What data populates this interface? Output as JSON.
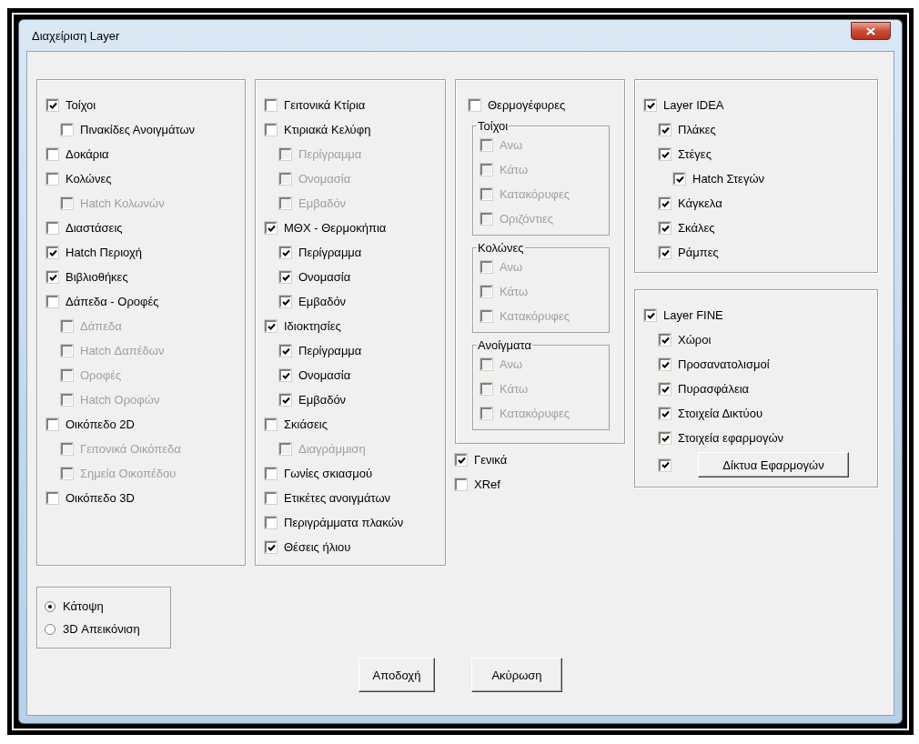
{
  "window": {
    "title": "Διαχείριση Layer"
  },
  "column_1": {
    "items": [
      {
        "label": "Τοίχοι",
        "checked": true,
        "disabled": false,
        "children": [
          {
            "label": "Πινακίδες Ανοιγμάτων",
            "checked": false,
            "disabled": false
          }
        ]
      },
      {
        "label": "Δοκάρια",
        "checked": false,
        "disabled": false
      },
      {
        "label": "Κολώνες",
        "checked": false,
        "disabled": false,
        "children": [
          {
            "label": "Hatch Κολωνών",
            "checked": false,
            "disabled": true
          }
        ]
      },
      {
        "label": "Διαστάσεις",
        "checked": false,
        "disabled": false
      },
      {
        "label": "Hatch Περιοχή",
        "checked": true,
        "disabled": false
      },
      {
        "label": "Βιβλιοθήκες",
        "checked": true,
        "disabled": false
      },
      {
        "label": "Δάπεδα - Οροφές",
        "checked": false,
        "disabled": false,
        "children": [
          {
            "label": "Δάπεδα",
            "checked": false,
            "disabled": true
          },
          {
            "label": "Hatch Δαπέδων",
            "checked": false,
            "disabled": true
          },
          {
            "label": "Οροφές",
            "checked": false,
            "disabled": true
          },
          {
            "label": "Hatch Οροφών",
            "checked": false,
            "disabled": true
          }
        ]
      },
      {
        "label": "Οικόπεδο 2D",
        "checked": false,
        "disabled": false,
        "children": [
          {
            "label": "Γειτονικά Οικόπεδα",
            "checked": false,
            "disabled": true
          },
          {
            "label": "Σημεία Οικοπέδου",
            "checked": false,
            "disabled": true
          }
        ]
      },
      {
        "label": "Οικόπεδο 3D",
        "checked": false,
        "disabled": false
      }
    ]
  },
  "column_2": {
    "items": [
      {
        "label": "Γειτονικά Κτίρια",
        "checked": false,
        "disabled": false
      },
      {
        "label": "Κτιριακά Κελύφη",
        "checked": false,
        "disabled": false,
        "children": [
          {
            "label": "Περίγραμμα",
            "checked": false,
            "disabled": true
          },
          {
            "label": "Ονομασία",
            "checked": false,
            "disabled": true
          },
          {
            "label": "Εμβαδόν",
            "checked": false,
            "disabled": true
          }
        ]
      },
      {
        "label": "ΜΘΧ - Θερμοκήπια",
        "checked": true,
        "disabled": false,
        "children": [
          {
            "label": "Περίγραμμα",
            "checked": true,
            "disabled": false
          },
          {
            "label": "Ονομασία",
            "checked": true,
            "disabled": false
          },
          {
            "label": "Εμβαδόν",
            "checked": true,
            "disabled": false
          }
        ]
      },
      {
        "label": "Ιδιοκτησίες",
        "checked": true,
        "disabled": false,
        "children": [
          {
            "label": "Περίγραμμα",
            "checked": true,
            "disabled": false
          },
          {
            "label": "Ονομασία",
            "checked": true,
            "disabled": false
          },
          {
            "label": "Εμβαδόν",
            "checked": true,
            "disabled": false
          }
        ]
      },
      {
        "label": "Σκιάσεις",
        "checked": false,
        "disabled": false,
        "children": [
          {
            "label": "Διαγράμμιση",
            "checked": false,
            "disabled": true
          }
        ]
      },
      {
        "label": "Γωνίες σκιασμού",
        "checked": false,
        "disabled": false
      },
      {
        "label": "Ετικέτες ανοιγμάτων",
        "checked": false,
        "disabled": false
      },
      {
        "label": "Περιγράμματα πλακών",
        "checked": false,
        "disabled": false
      },
      {
        "label": "Θέσεις ήλιου",
        "checked": true,
        "disabled": false
      }
    ]
  },
  "column_3": {
    "thermal_bridges": {
      "label": "Θερμογέφυρες",
      "checked": false,
      "disabled": false
    },
    "groups": [
      {
        "title": "Τοίχοι",
        "items": [
          {
            "label": "Ανω",
            "checked": false,
            "disabled": true
          },
          {
            "label": "Κάτω",
            "checked": false,
            "disabled": true
          },
          {
            "label": "Κατακόρυφες",
            "checked": false,
            "disabled": true
          },
          {
            "label": "Οριζόντιες",
            "checked": false,
            "disabled": true
          }
        ]
      },
      {
        "title": "Κολώνες",
        "items": [
          {
            "label": "Ανω",
            "checked": false,
            "disabled": true
          },
          {
            "label": "Κάτω",
            "checked": false,
            "disabled": true
          },
          {
            "label": "Κατακόρυφες",
            "checked": false,
            "disabled": true
          }
        ]
      },
      {
        "title": "Ανοίγματα",
        "items": [
          {
            "label": "Ανω",
            "checked": false,
            "disabled": true
          },
          {
            "label": "Κάτω",
            "checked": false,
            "disabled": true
          },
          {
            "label": "Κατακόρυφες",
            "checked": false,
            "disabled": true
          }
        ]
      }
    ],
    "extra_items": [
      {
        "label": "Γενικά",
        "checked": true,
        "disabled": false
      },
      {
        "label": "XRef",
        "checked": false,
        "disabled": false
      }
    ]
  },
  "layer_panels": [
    {
      "items": [
        {
          "label": "Layer IDEA",
          "checked": true,
          "disabled": false,
          "children": [
            {
              "label": "Πλάκες",
              "checked": true,
              "disabled": false
            },
            {
              "label": "Στέγες",
              "checked": true,
              "disabled": false,
              "children": [
                {
                  "label": "Hatch Στεγών",
                  "checked": true,
                  "disabled": false
                }
              ]
            },
            {
              "label": "Κάγκελα",
              "checked": true,
              "disabled": false
            },
            {
              "label": "Σκάλες",
              "checked": true,
              "disabled": false
            },
            {
              "label": "Ράμπες",
              "checked": true,
              "disabled": false
            }
          ]
        }
      ]
    },
    {
      "items": [
        {
          "label": "Layer FINE",
          "checked": true,
          "disabled": false,
          "children": [
            {
              "kind": "checkbox",
              "label": "Χώροι",
              "checked": true,
              "disabled": false
            },
            {
              "kind": "checkbox",
              "label": "Προσανατολισμοί",
              "checked": true,
              "disabled": false
            },
            {
              "kind": "checkbox",
              "label": "Πυρασφάλεια",
              "checked": true,
              "disabled": false
            },
            {
              "kind": "checkbox",
              "label": "Στοιχεία Δικτύου",
              "checked": true,
              "disabled": false
            },
            {
              "kind": "checkbox",
              "label": "Στοιχεία εφαρμογών",
              "checked": true,
              "disabled": false
            },
            {
              "kind": "button",
              "button": "Δίκτυα Εφαρμογών",
              "checked": true,
              "disabled": false
            }
          ]
        }
      ]
    }
  ],
  "view_mode": [
    {
      "label": "Κάτοψη",
      "selected": true
    },
    {
      "label": "3D Απεικόνιση",
      "selected": false
    }
  ],
  "buttons": [
    "Αποδοχή",
    "Ακύρωση"
  ]
}
